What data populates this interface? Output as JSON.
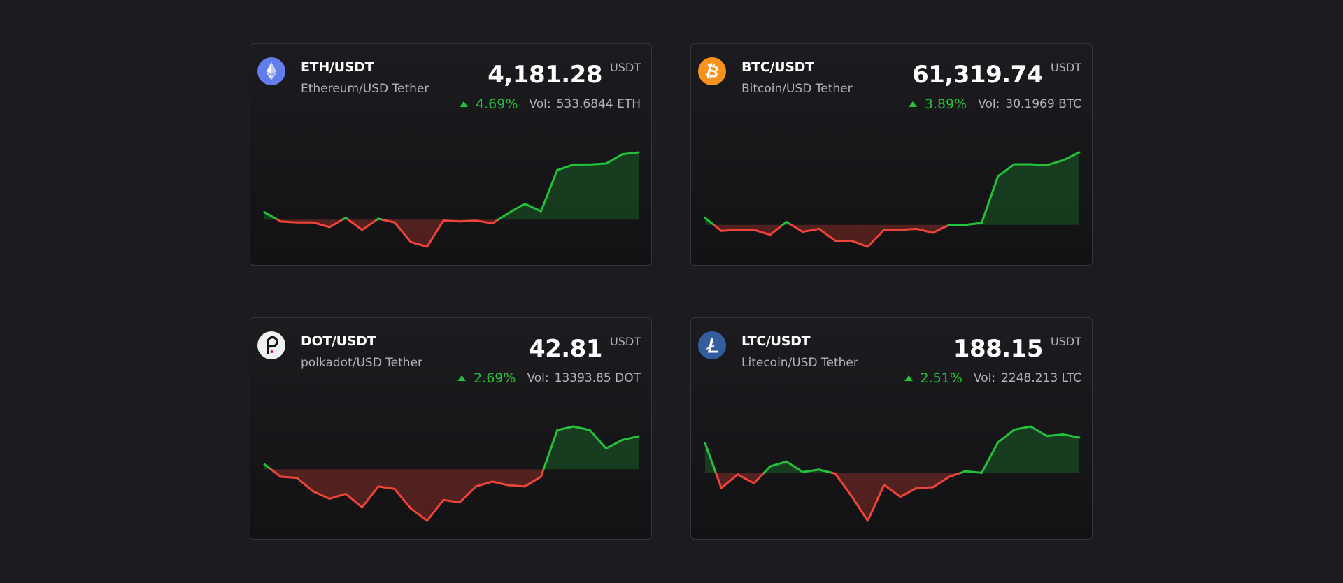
{
  "cards": [
    {
      "pair": "ETH/USDT",
      "name": "Ethereum/USD Tether",
      "price": "4,181.28",
      "quote": "USDT",
      "change": "4.69%",
      "vol_label": "Vol:",
      "volume": "533.6844 ETH",
      "icon": "ethereum-icon",
      "logo_color": "#627eea",
      "chart_data": {
        "type": "area",
        "baseline": 0,
        "values": [
          0.8,
          -0.2,
          -0.3,
          -0.3,
          -0.8,
          0.2,
          -1.1,
          0.1,
          -0.3,
          -2.4,
          -2.9,
          -0.1,
          -0.2,
          -0.1,
          -0.4,
          0.7,
          1.7,
          0.9,
          5.3,
          5.9,
          5.9,
          6.0,
          7.0,
          7.2
        ],
        "colors": {
          "up": "#22c23a",
          "down": "#f04438"
        }
      }
    },
    {
      "pair": "BTC/USDT",
      "name": "Bitcoin/USD Tether",
      "price": "61,319.74",
      "quote": "USDT",
      "change": "3.89%",
      "vol_label": "Vol:",
      "volume": "30.1969 BTC",
      "icon": "bitcoin-icon",
      "logo_color": "#f7931a",
      "chart_data": {
        "type": "area",
        "baseline": 0,
        "values": [
          0.7,
          -0.6,
          -0.5,
          -0.5,
          -1.0,
          0.3,
          -0.7,
          -0.4,
          -1.6,
          -1.6,
          -2.2,
          -0.5,
          -0.5,
          -0.4,
          -0.8,
          0.0,
          0.0,
          0.2,
          4.9,
          6.1,
          6.1,
          6.0,
          6.5,
          7.3
        ],
        "colors": {
          "up": "#22c23a",
          "down": "#f04438"
        }
      }
    },
    {
      "pair": "DOT/USDT",
      "name": "polkadot/USD Tether",
      "price": "42.81",
      "quote": "USDT",
      "change": "2.69%",
      "vol_label": "Vol:",
      "volume": "13393.85 DOT",
      "icon": "polkadot-icon",
      "logo_color": "#f2f2f2",
      "chart_data": {
        "type": "area",
        "baseline": 0,
        "values": [
          0.4,
          -0.6,
          -0.7,
          -1.8,
          -2.4,
          -2.0,
          -3.1,
          -1.4,
          -1.6,
          -3.2,
          -4.2,
          -2.5,
          -2.7,
          -1.4,
          -1.0,
          -1.3,
          -1.4,
          -0.6,
          3.2,
          3.5,
          3.2,
          1.7,
          2.4,
          2.7
        ],
        "colors": {
          "up": "#22c23a",
          "down": "#f04438"
        }
      }
    },
    {
      "pair": "LTC/USDT",
      "name": "Litecoin/USD Tether",
      "price": "188.15",
      "quote": "USDT",
      "change": "2.51%",
      "vol_label": "Vol:",
      "volume": "2248.213 LTC",
      "icon": "litecoin-icon",
      "logo_color": "#345d9d",
      "chart_data": {
        "type": "area",
        "baseline": 0,
        "values": [
          3.7,
          -1.9,
          -0.2,
          -1.3,
          0.8,
          1.4,
          0.1,
          0.4,
          -0.1,
          -2.9,
          -6.0,
          -1.5,
          -3.0,
          -1.9,
          -1.8,
          -0.5,
          0.2,
          0.0,
          3.8,
          5.4,
          5.8,
          4.6,
          4.8,
          4.4
        ],
        "colors": {
          "up": "#22c23a",
          "down": "#f04438"
        }
      }
    }
  ]
}
